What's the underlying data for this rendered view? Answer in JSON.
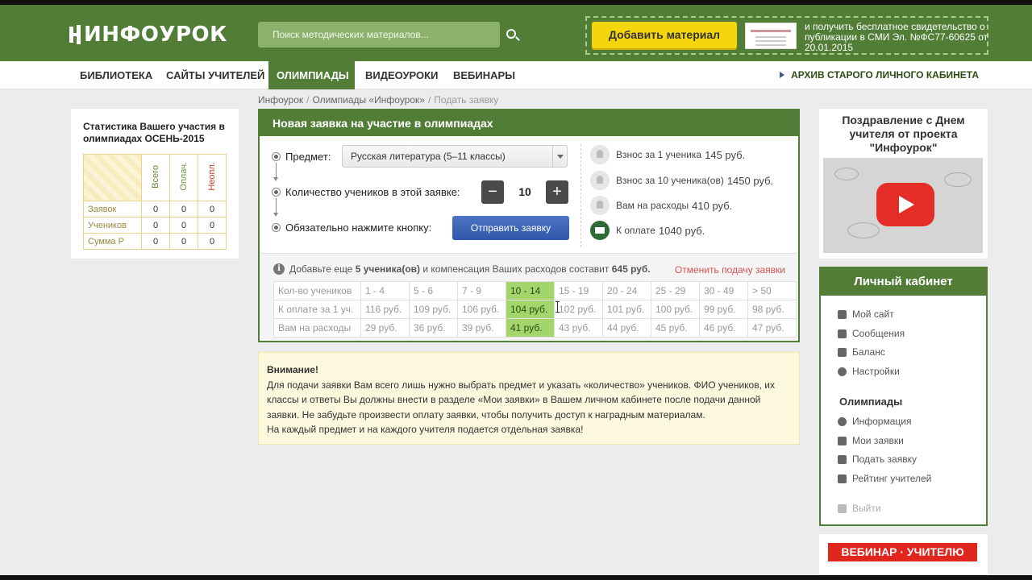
{
  "header": {
    "logo_text": "ИНФОУРОК",
    "search_placeholder": "Поиск методических материалов...",
    "add_material": "Добавить материал",
    "promo_text": "и получить бесплатное свидетельство о публикации в СМИ Эл. №ФС77-60625 от 20.01.2015"
  },
  "nav": {
    "items": [
      "БИБЛИОТЕКА",
      "САЙТЫ УЧИТЕЛЕЙ",
      "ОЛИМПИАДЫ",
      "ВИДЕОУРОКИ",
      "ВЕБИНАРЫ"
    ],
    "active_index": 2,
    "archive": "АРХИВ СТАРОГО ЛИЧНОГО КАБИНЕТА"
  },
  "breadcrumb": [
    "Инфоурок",
    "Олимпиады «Инфоурок»",
    "Подать заявку"
  ],
  "stats": {
    "title": "Статистика Вашего участия в олимпиадах ОСЕНЬ-2015",
    "columns": [
      "Всего",
      "Оплач.",
      "Неопл."
    ],
    "rows": [
      {
        "label": "Заявок",
        "values": [
          "0",
          "0",
          "0"
        ]
      },
      {
        "label": "Учеников",
        "values": [
          "0",
          "0",
          "0"
        ]
      },
      {
        "label": "Сумма Р",
        "values": [
          "0",
          "0",
          "0"
        ]
      }
    ]
  },
  "form": {
    "title": "Новая заявка на участие в олимпиадах",
    "subject_label": "Предмет:",
    "subject_value": "Русская литература (5–11 классы)",
    "count_label": "Количество учеников в этой заявке:",
    "count_value": "10",
    "minus": "−",
    "plus": "+",
    "submit_label": "Обязательно нажмите кнопку:",
    "submit_button": "Отправить заявку",
    "prices": [
      {
        "label": "Взнос за 1 ученика",
        "amount": "145 руб."
      },
      {
        "label": "Взнос за 10 ученика(ов)",
        "amount": "1450 руб."
      },
      {
        "label": "Вам на расходы",
        "amount": "410 руб."
      },
      {
        "label": "К оплате",
        "amount": "1040 руб."
      }
    ],
    "hint_prefix": "Добавьте еще",
    "hint_count": "5 ученика(ов)",
    "hint_mid": "и компенсация Ваших расходов составит",
    "hint_amount": "645 руб.",
    "cancel_link": "Отменить подачу заявки",
    "price_table": {
      "rows": [
        {
          "label": "Кол-во учеников",
          "cells": [
            "1 - 4",
            "5 - 6",
            "7 - 9",
            "10 - 14",
            "15 - 19",
            "20 - 24",
            "25 - 29",
            "30 - 49",
            "> 50"
          ]
        },
        {
          "label": "К оплате за 1 уч.",
          "cells": [
            "116 руб.",
            "109 руб.",
            "106 руб.",
            "104 руб.",
            "102 руб.",
            "101 руб.",
            "100 руб.",
            "99 руб.",
            "98 руб."
          ]
        },
        {
          "label": "Вам на расходы",
          "cells": [
            "29 руб.",
            "36 руб.",
            "39 руб.",
            "41 руб.",
            "43 руб.",
            "44 руб.",
            "45 руб.",
            "46 руб.",
            "47 руб."
          ]
        }
      ],
      "highlight_col": 3
    }
  },
  "notice": {
    "title": "Внимание!",
    "text1": "Для подачи заявки Вам всего лишь нужно выбрать предмет и указать «количество» учеников. ФИО учеников, их классы и ответы Вы должны внести в разделе «Мои заявки» в Вашем личном кабинете после подачи данной заявки. Не забудьте произвести оплату заявки, чтобы получить доступ к наградным материалам.",
    "text2": "На каждый предмет и на каждого учителя подается отдельная заявка!"
  },
  "video": {
    "title": "Поздравление с Днем учителя от проекта \"Инфоурок\"",
    "icon": "youtube-play-icon"
  },
  "cabinet": {
    "title": "Личный кабинет",
    "items": [
      "Мой сайт",
      "Сообщения",
      "Баланс",
      "Настройки"
    ],
    "olymp_title": "Олимпиады",
    "olymp_items": [
      "Информация",
      "Мои заявки",
      "Подать заявку",
      "Рейтинг учителей"
    ],
    "logout": "Выйти"
  },
  "webinar": {
    "label": "ВЕБИНАР · УЧИТЕЛЮ"
  },
  "colors": {
    "brand_green": "#517d37",
    "accent_yellow": "#f5d60d",
    "highlight": "#a4d56d",
    "submit_blue": "#2f58aa"
  }
}
